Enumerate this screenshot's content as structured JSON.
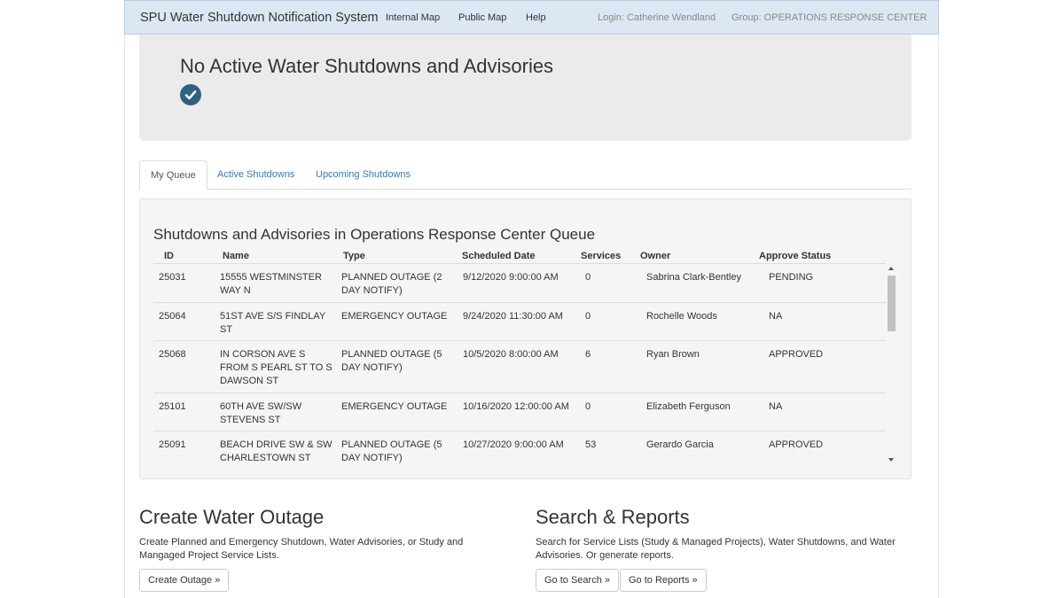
{
  "navbar": {
    "brand": "SPU Water Shutdown Notification System",
    "links": [
      "Internal Map",
      "Public Map",
      "Help"
    ],
    "login": "Login: Catherine Wendland",
    "group": "Group: OPERATIONS RESPONSE CENTER"
  },
  "banner": {
    "title": "No Active Water Shutdowns and Advisories",
    "icon": "check-circle-icon"
  },
  "tabs": [
    "My Queue",
    "Active Shutdowns",
    "Upcoming Shutdowns"
  ],
  "active_tab": "My Queue",
  "queue": {
    "title": "Shutdowns and Advisories in Operations Response Center Queue",
    "columns": [
      "ID",
      "Name",
      "Type",
      "Scheduled Date",
      "Services",
      "Owner",
      "Approve Status"
    ],
    "rows": [
      {
        "id": "25031",
        "name": "15555 WESTMINSTER WAY N",
        "type": "PLANNED OUTAGE (2 DAY NOTIFY)",
        "date": "9/12/2020 9:00:00 AM",
        "services": "0",
        "owner": "Sabrina Clark-Bentley",
        "status": "PENDING"
      },
      {
        "id": "25064",
        "name": "51ST AVE S/S FINDLAY ST",
        "type": "EMERGENCY OUTAGE",
        "date": "9/24/2020 11:30:00 AM",
        "services": "0",
        "owner": "Rochelle Woods",
        "status": "NA"
      },
      {
        "id": "25068",
        "name": "IN CORSON AVE S FROM S PEARL ST TO S DAWSON ST",
        "type": "PLANNED OUTAGE (5 DAY NOTIFY)",
        "date": "10/5/2020 8:00:00 AM",
        "services": "6",
        "owner": "Ryan Brown",
        "status": "APPROVED"
      },
      {
        "id": "25101",
        "name": "60TH AVE SW/SW STEVENS ST",
        "type": "EMERGENCY OUTAGE",
        "date": "10/16/2020 12:00:00 AM",
        "services": "0",
        "owner": "Elizabeth Ferguson",
        "status": "NA"
      },
      {
        "id": "25091",
        "name": "BEACH DRIVE SW & SW CHARLESTOWN ST",
        "type": "PLANNED OUTAGE (5 DAY NOTIFY)",
        "date": "10/27/2020 9:00:00 AM",
        "services": "53",
        "owner": "Gerardo Garcia",
        "status": "APPROVED"
      }
    ]
  },
  "create": {
    "title": "Create Water Outage",
    "description": "Create Planned and Emergency Shutdown, Water Advisories, or Study and Mangaged Project Service Lists.",
    "button": "Create Outage »"
  },
  "reports": {
    "title": "Search & Reports",
    "description": "Search for Service Lists (Study & Managed Projects), Water Shutdowns, and Water Advisories. Or generate reports.",
    "buttons": [
      "Go to Search »",
      "Go to Reports »"
    ]
  },
  "colors": {
    "navbar_bg": "#dce7f3",
    "link": "#337ab7",
    "check_icon": "#2e6282"
  }
}
